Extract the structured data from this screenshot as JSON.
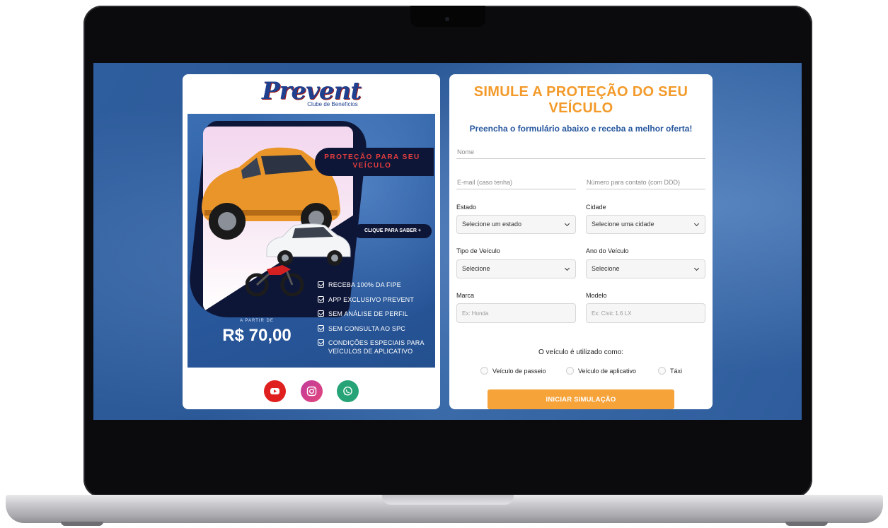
{
  "brand": {
    "name": "Prevent",
    "tagline": "Clube de Benefícios"
  },
  "banner": {
    "headline": "PROTEÇÃO PARA SEU VEÍCULO",
    "cta": "CLIQUE PARA SABER +",
    "price_prefix": "A PARTIR DE",
    "price": "R$ 70,00",
    "benefits": [
      "RECEBA 100% DA FIPE",
      "APP EXCLUSIVO PREVENT",
      "SEM ANÁLISE DE PERFIL",
      "SEM CONSULTA AO SPC",
      "CONDIÇÕES ESPECIAIS PARA VEÍCULOS DE APLICATIVO"
    ]
  },
  "social": [
    {
      "name": "youtube-icon",
      "color": "#e01f1f"
    },
    {
      "name": "instagram-icon",
      "color": "#d1408c"
    },
    {
      "name": "whatsapp-icon",
      "color": "#27a477"
    }
  ],
  "form": {
    "title": "SIMULE A PROTEÇÃO DO SEU VEÍCULO",
    "subtitle": "Preencha o formulário abaixo e receba a melhor oferta!",
    "name_placeholder": "Nome",
    "email_placeholder": "E-mail (caso tenha)",
    "phone_placeholder": "Número para contato (com DDD)",
    "state_label": "Estado",
    "state_value": "Selecione um estado",
    "city_label": "Cidade",
    "city_value": "Selecione uma cidade",
    "vehicle_type_label": "Tipo de Veículo",
    "vehicle_type_value": "Selecione",
    "vehicle_year_label": "Ano do Veículo",
    "vehicle_year_value": "Selecione",
    "brand_label": "Marca",
    "brand_placeholder": "Ex: Honda",
    "model_label": "Modelo",
    "model_placeholder": "Ex: Civic 1.6 LX",
    "usage_question": "O veículo é utilizado como:",
    "usage_options": [
      "Veículo de passeio",
      "Veículo de aplicativo",
      "Táxi"
    ],
    "submit_label": "INICIAR SIMULAÇÃO"
  },
  "colors": {
    "accent_orange": "#f39a2a",
    "button_orange": "#f6a33a",
    "brand_blue": "#1f3f8f",
    "subtitle_blue": "#27579e",
    "screen_blue": "#2f5e9e"
  }
}
